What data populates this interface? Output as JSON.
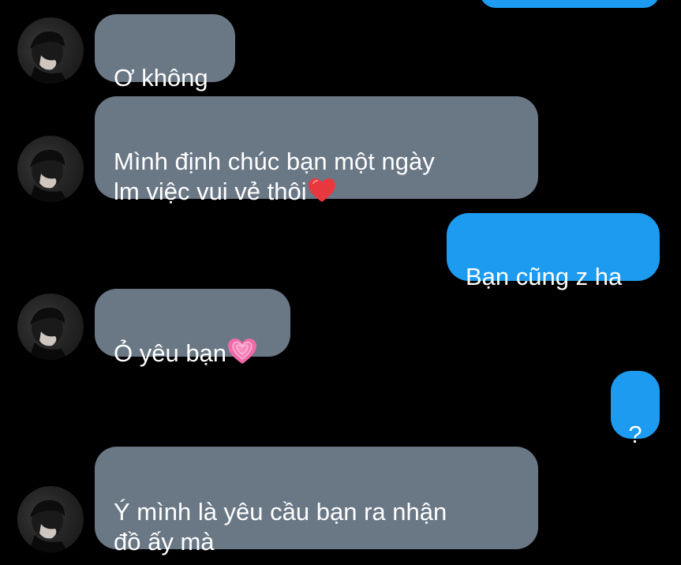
{
  "conversation": {
    "messages": [
      {
        "direction": "incoming",
        "text": "Ơ không"
      },
      {
        "direction": "incoming",
        "text": "Mình định chúc bạn một ngày\nlm việc vui vẻ thôi",
        "emoji": "red-heart-icon"
      },
      {
        "direction": "outgoing",
        "text": "Bạn cũng z ha"
      },
      {
        "direction": "incoming",
        "text": "Ỏ yêu bạn",
        "emoji": "growing-pink-heart-icon"
      },
      {
        "direction": "outgoing",
        "text": "?"
      },
      {
        "direction": "incoming",
        "text": "Ý mình là yêu cầu bạn ra nhận\nđồ ấy mà"
      }
    ]
  },
  "colors": {
    "background": "#000000",
    "incoming_bubble": "#6a7785",
    "outgoing_bubble": "#1d9bf0",
    "text": "#ffffff"
  }
}
